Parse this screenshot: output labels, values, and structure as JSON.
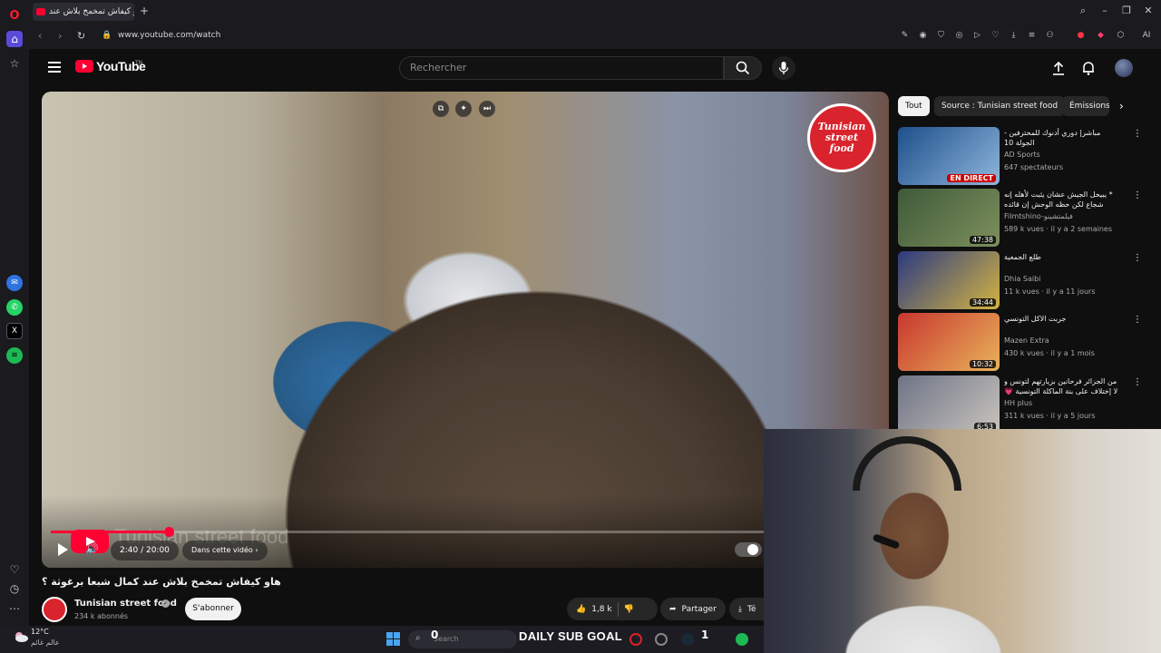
{
  "browser": {
    "tab_title": "هاو كيفاش تمخمخ بلاش عند",
    "url": "www.youtube.com/watch",
    "new_tab": "+",
    "ai_label": "AI"
  },
  "youtube": {
    "logo_text": "YouTube",
    "country_code": "TN",
    "search_placeholder": "Rechercher"
  },
  "player": {
    "watermark": "Tunisian street food",
    "time": "2:40 / 20:00",
    "chapter_label": "Dans cette vidéo",
    "progress_fraction": 0.166,
    "badge_line1": "Tunisian",
    "badge_line2": "street",
    "badge_line3": "food"
  },
  "video": {
    "title": "هاو كيفاش تمخمخ بلاش عند كمال شبعا برغوثة ؟",
    "channel": "Tunisian street food",
    "subscribers": "234 k abonnés",
    "subscribe_label": "S'abonner",
    "likes": "1,8 k",
    "share_label": "Partager",
    "download_label": "Té"
  },
  "chips": [
    "Tout",
    "Source : Tunisian street food",
    "Émissions"
  ],
  "recommendations": [
    {
      "title": "مباشر| دوري أدنوك للمحترفين - الجولة 10",
      "channel": "AD Sports",
      "meta": "647 spectateurs",
      "badge": "EN DIRECT",
      "live": true,
      "colors": [
        "#1d4f8a",
        "#8fb6dc"
      ]
    },
    {
      "title": "* يبيحل الجيش عشان يثبت لأهله إنه شجاع لكن حظه الوحش إن قائده المعسكر بتطلع ...",
      "channel": "Filmtshino-فيلمتشينو",
      "meta": "589 k vues · il y a 2 semaines",
      "badge": "47:38",
      "live": false,
      "colors": [
        "#3f5a3a",
        "#7d8f5c"
      ]
    },
    {
      "title": "طلع الجمعية",
      "channel": "Dhia Saibi",
      "meta": "11 k vues · il y a 11 jours",
      "badge": "34:44",
      "live": false,
      "colors": [
        "#2b3a80",
        "#d4b443"
      ]
    },
    {
      "title": "جربت الاكل التونسي",
      "channel": "Mazen Extra",
      "meta": "430 k vues · il y a 1 mois",
      "badge": "10:32",
      "live": false,
      "colors": [
        "#c8372f",
        "#e9b35a"
      ]
    },
    {
      "title": "من الجزائر فرحانين بزيارتهم لتونس و لا إختلاف على بنة الماكلة التونسية 💗😍",
      "channel": "HH plus",
      "meta": "311 k vues · il y a 5 jours",
      "badge": "6:53",
      "live": false,
      "colors": [
        "#6e7486",
        "#c9c4bd"
      ]
    }
  ],
  "taskbar": {
    "temperature": "12°C",
    "location": "عالم غائم",
    "search_placeholder": "Search",
    "goal_label": "DAILY SUB GOAL",
    "goal_current": "0",
    "goal_target": "1"
  },
  "colors": {
    "accent": "#ff0033",
    "background": "#0f0f0f"
  }
}
